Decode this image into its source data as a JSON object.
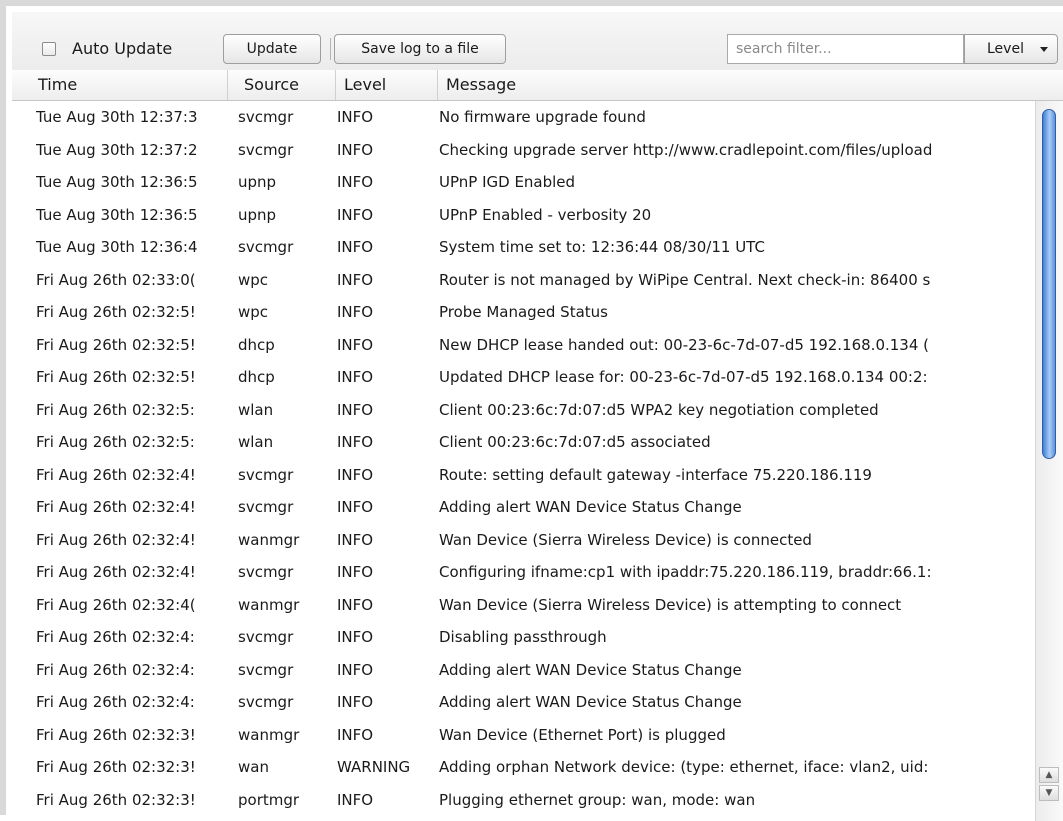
{
  "toolbar": {
    "auto_update_label": "Auto Update",
    "auto_update_checked": false,
    "update_label": "Update",
    "save_log_label": "Save log to a file",
    "search_placeholder": "search filter...",
    "level_label": "Level"
  },
  "columns": {
    "time": "Time",
    "source": "Source",
    "level": "Level",
    "message": "Message"
  },
  "rows": [
    {
      "time": "Tue Aug 30th 12:37:3",
      "source": "svcmgr",
      "level": "INFO",
      "message": "No firmware upgrade found"
    },
    {
      "time": "Tue Aug 30th 12:37:2",
      "source": "svcmgr",
      "level": "INFO",
      "message": "Checking upgrade server http://www.cradlepoint.com/files/upload"
    },
    {
      "time": "Tue Aug 30th 12:36:5",
      "source": "upnp",
      "level": "INFO",
      "message": "UPnP IGD Enabled"
    },
    {
      "time": "Tue Aug 30th 12:36:5",
      "source": "upnp",
      "level": "INFO",
      "message": "UPnP Enabled - verbosity 20"
    },
    {
      "time": "Tue Aug 30th 12:36:4",
      "source": "svcmgr",
      "level": "INFO",
      "message": "System time set to: 12:36:44 08/30/11 UTC"
    },
    {
      "time": "Fri Aug 26th 02:33:0(",
      "source": "wpc",
      "level": "INFO",
      "message": "Router is not managed by WiPipe Central. Next check-in: 86400 s"
    },
    {
      "time": "Fri Aug 26th 02:32:5!",
      "source": "wpc",
      "level": "INFO",
      "message": "Probe Managed Status"
    },
    {
      "time": "Fri Aug 26th 02:32:5!",
      "source": "dhcp",
      "level": "INFO",
      "message": "New DHCP lease handed out: 00-23-6c-7d-07-d5 192.168.0.134 ("
    },
    {
      "time": "Fri Aug 26th 02:32:5!",
      "source": "dhcp",
      "level": "INFO",
      "message": "Updated DHCP lease for: 00-23-6c-7d-07-d5 192.168.0.134 00:2:"
    },
    {
      "time": "Fri Aug 26th 02:32:5:",
      "source": "wlan",
      "level": "INFO",
      "message": "Client 00:23:6c:7d:07:d5 WPA2 key negotiation completed"
    },
    {
      "time": "Fri Aug 26th 02:32:5:",
      "source": "wlan",
      "level": "INFO",
      "message": "Client 00:23:6c:7d:07:d5 associated"
    },
    {
      "time": "Fri Aug 26th 02:32:4!",
      "source": "svcmgr",
      "level": "INFO",
      "message": "Route: setting default gateway -interface 75.220.186.119"
    },
    {
      "time": "Fri Aug 26th 02:32:4!",
      "source": "svcmgr",
      "level": "INFO",
      "message": "Adding alert WAN Device Status Change"
    },
    {
      "time": "Fri Aug 26th 02:32:4!",
      "source": "wanmgr",
      "level": "INFO",
      "message": "Wan Device (Sierra Wireless Device) is connected"
    },
    {
      "time": "Fri Aug 26th 02:32:4!",
      "source": "svcmgr",
      "level": "INFO",
      "message": "Configuring ifname:cp1 with ipaddr:75.220.186.119, braddr:66.1:"
    },
    {
      "time": "Fri Aug 26th 02:32:4(",
      "source": "wanmgr",
      "level": "INFO",
      "message": "Wan Device (Sierra Wireless Device) is attempting to connect"
    },
    {
      "time": "Fri Aug 26th 02:32:4:",
      "source": "svcmgr",
      "level": "INFO",
      "message": "Disabling passthrough"
    },
    {
      "time": "Fri Aug 26th 02:32:4:",
      "source": "svcmgr",
      "level": "INFO",
      "message": "Adding alert WAN Device Status Change"
    },
    {
      "time": "Fri Aug 26th 02:32:4:",
      "source": "svcmgr",
      "level": "INFO",
      "message": "Adding alert WAN Device Status Change"
    },
    {
      "time": "Fri Aug 26th 02:32:3!",
      "source": "wanmgr",
      "level": "INFO",
      "message": "Wan Device (Ethernet Port) is plugged"
    },
    {
      "time": "Fri Aug 26th 02:32:3!",
      "source": "wan",
      "level": "WARNING",
      "message": "Adding orphan Network device: (type: ethernet, iface: vlan2, uid:"
    },
    {
      "time": "Fri Aug 26th 02:32:3!",
      "source": "portmgr",
      "level": "INFO",
      "message": "Plugging ethernet group: wan, mode: wan"
    }
  ]
}
